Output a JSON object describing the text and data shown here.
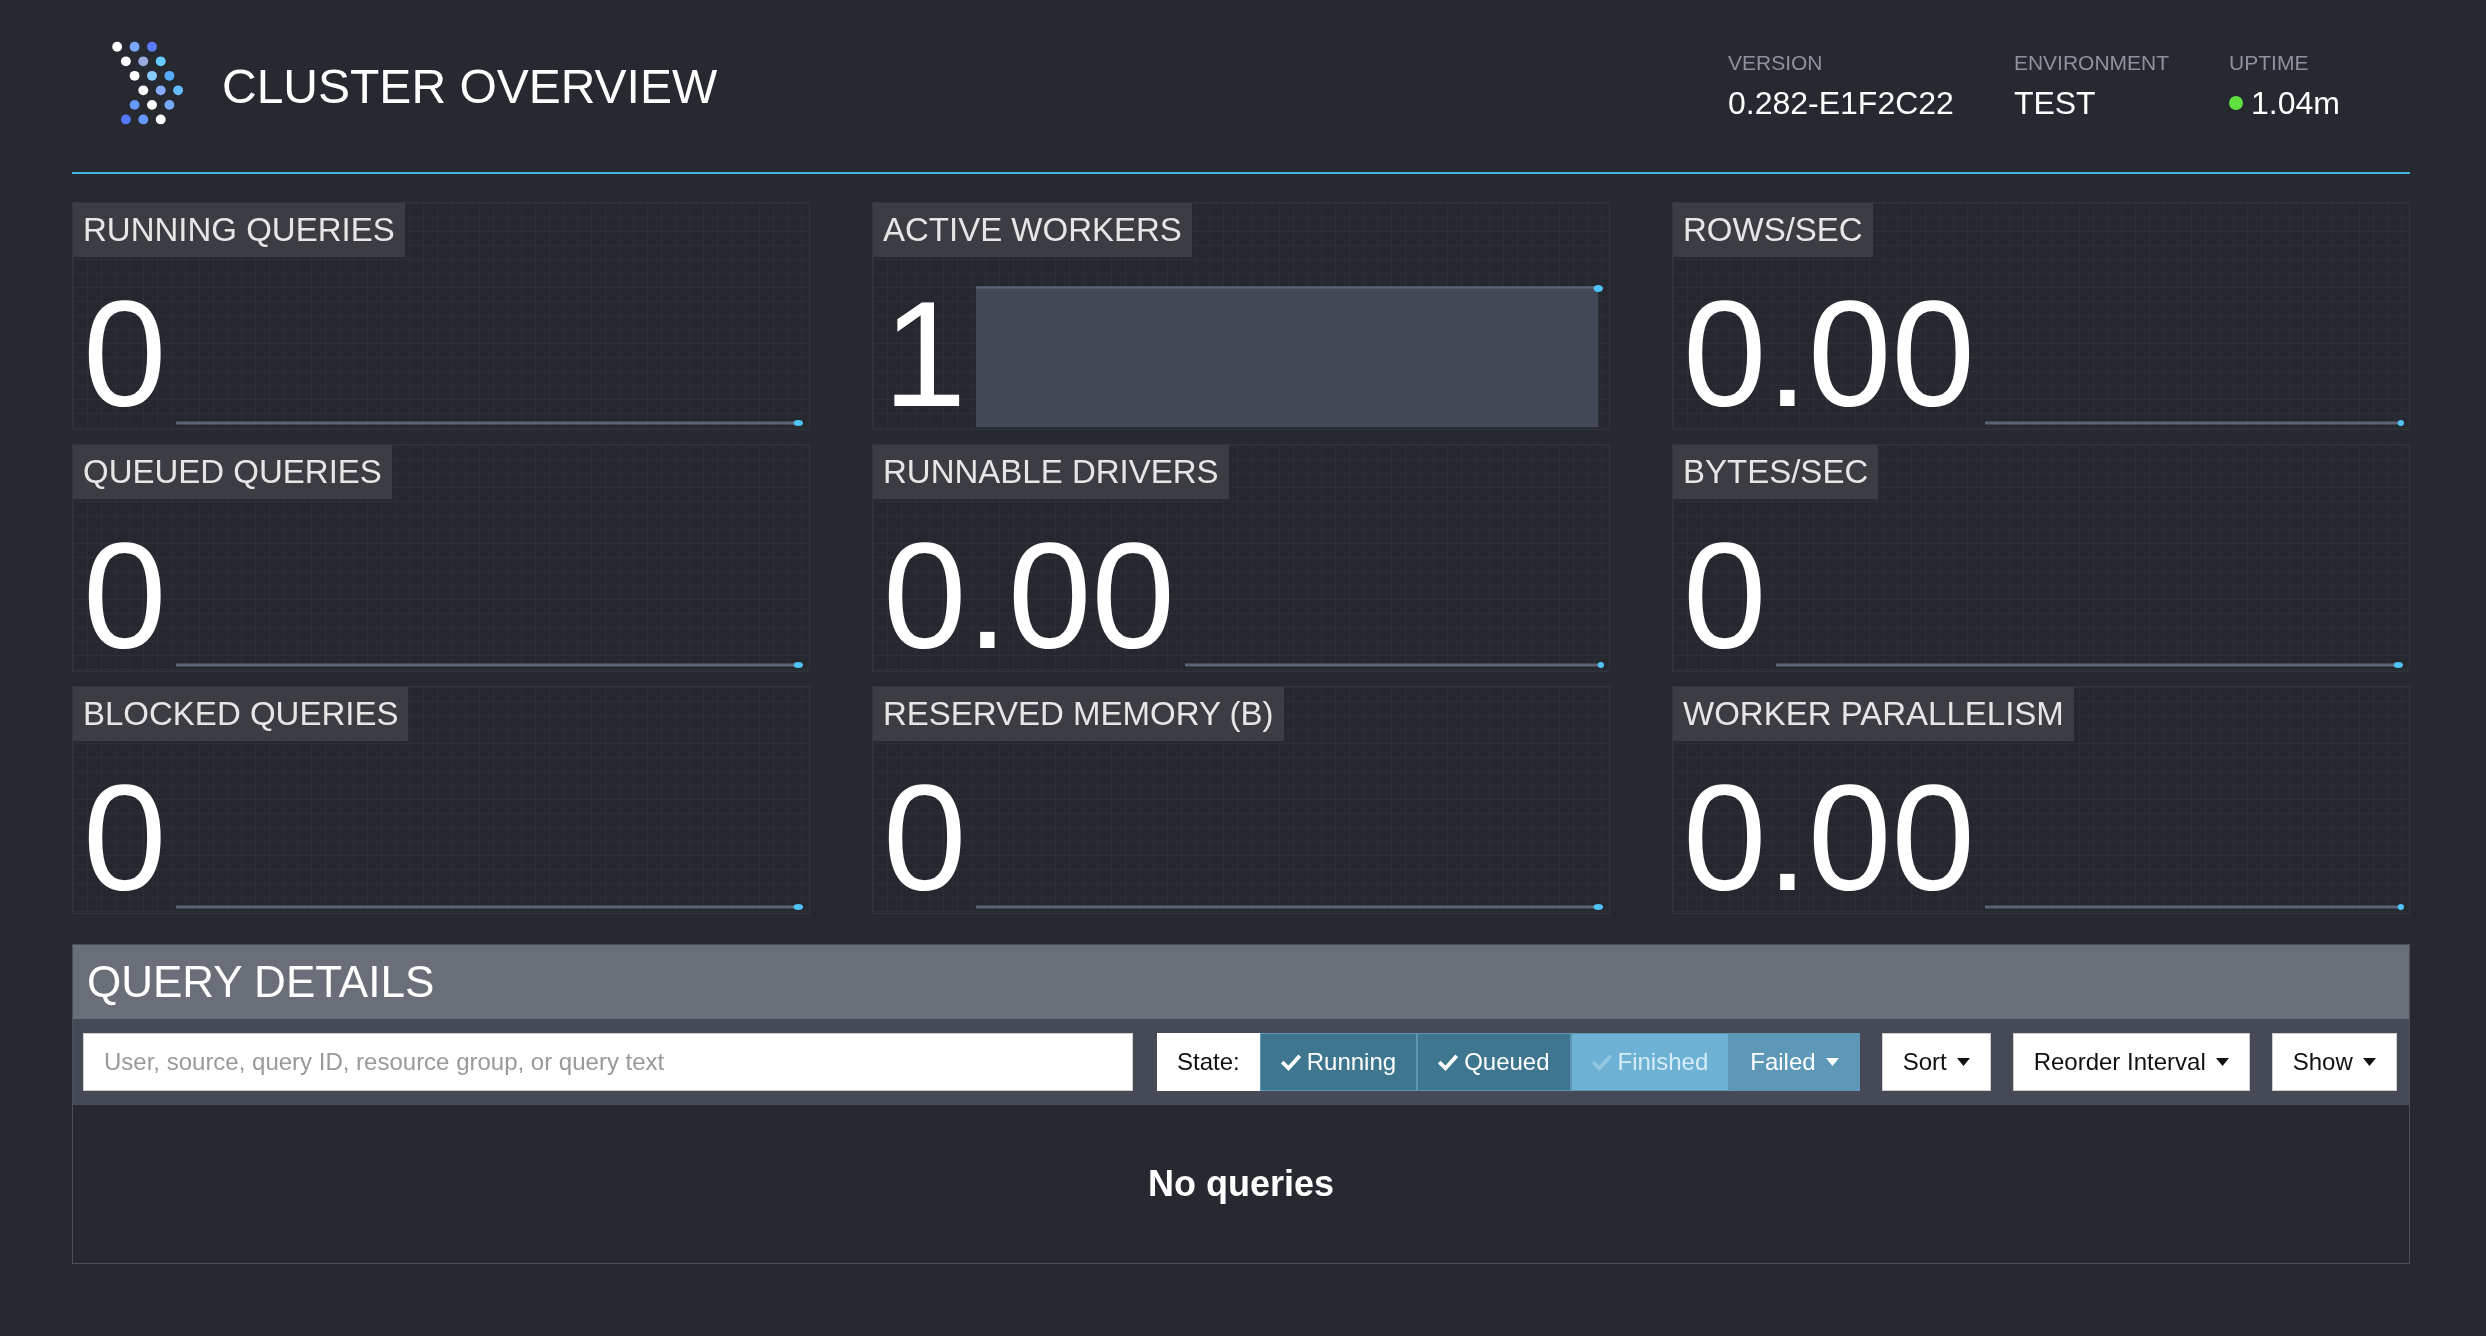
{
  "header": {
    "title": "CLUSTER OVERVIEW",
    "stats": [
      {
        "label": "VERSION",
        "value": "0.282-E1F2C22",
        "status_dot": false
      },
      {
        "label": "ENVIRONMENT",
        "value": "TEST",
        "status_dot": false
      },
      {
        "label": "UPTIME",
        "value": "1.04m",
        "status_dot": true
      }
    ]
  },
  "tiles": [
    {
      "label": "RUNNING QUERIES",
      "value": "0",
      "kind": "flat"
    },
    {
      "label": "ACTIVE WORKERS",
      "value": "1",
      "kind": "area"
    },
    {
      "label": "ROWS/SEC",
      "value": "0.00",
      "kind": "flat"
    },
    {
      "label": "QUEUED QUERIES",
      "value": "0",
      "kind": "flat"
    },
    {
      "label": "RUNNABLE DRIVERS",
      "value": "0.00",
      "kind": "flat"
    },
    {
      "label": "BYTES/SEC",
      "value": "0",
      "kind": "flat"
    },
    {
      "label": "BLOCKED QUERIES",
      "value": "0",
      "kind": "flat"
    },
    {
      "label": "RESERVED MEMORY (B)",
      "value": "0",
      "kind": "flat"
    },
    {
      "label": "WORKER PARALLELISM",
      "value": "0.00",
      "kind": "flat"
    }
  ],
  "query_details": {
    "title": "QUERY DETAILS",
    "search": {
      "placeholder": "User, source, query ID, resource group, or query text"
    },
    "state_label": "State:",
    "state_filters": [
      {
        "label": "Running",
        "kind": "toggle",
        "selected": true
      },
      {
        "label": "Queued",
        "kind": "toggle",
        "selected": true
      },
      {
        "label": "Finished",
        "kind": "toggle",
        "selected": false
      },
      {
        "label": "Failed",
        "kind": "dropdown",
        "selected": false
      }
    ],
    "menus": [
      "Sort",
      "Reorder Interval",
      "Show"
    ],
    "empty_message": "No queries"
  }
}
